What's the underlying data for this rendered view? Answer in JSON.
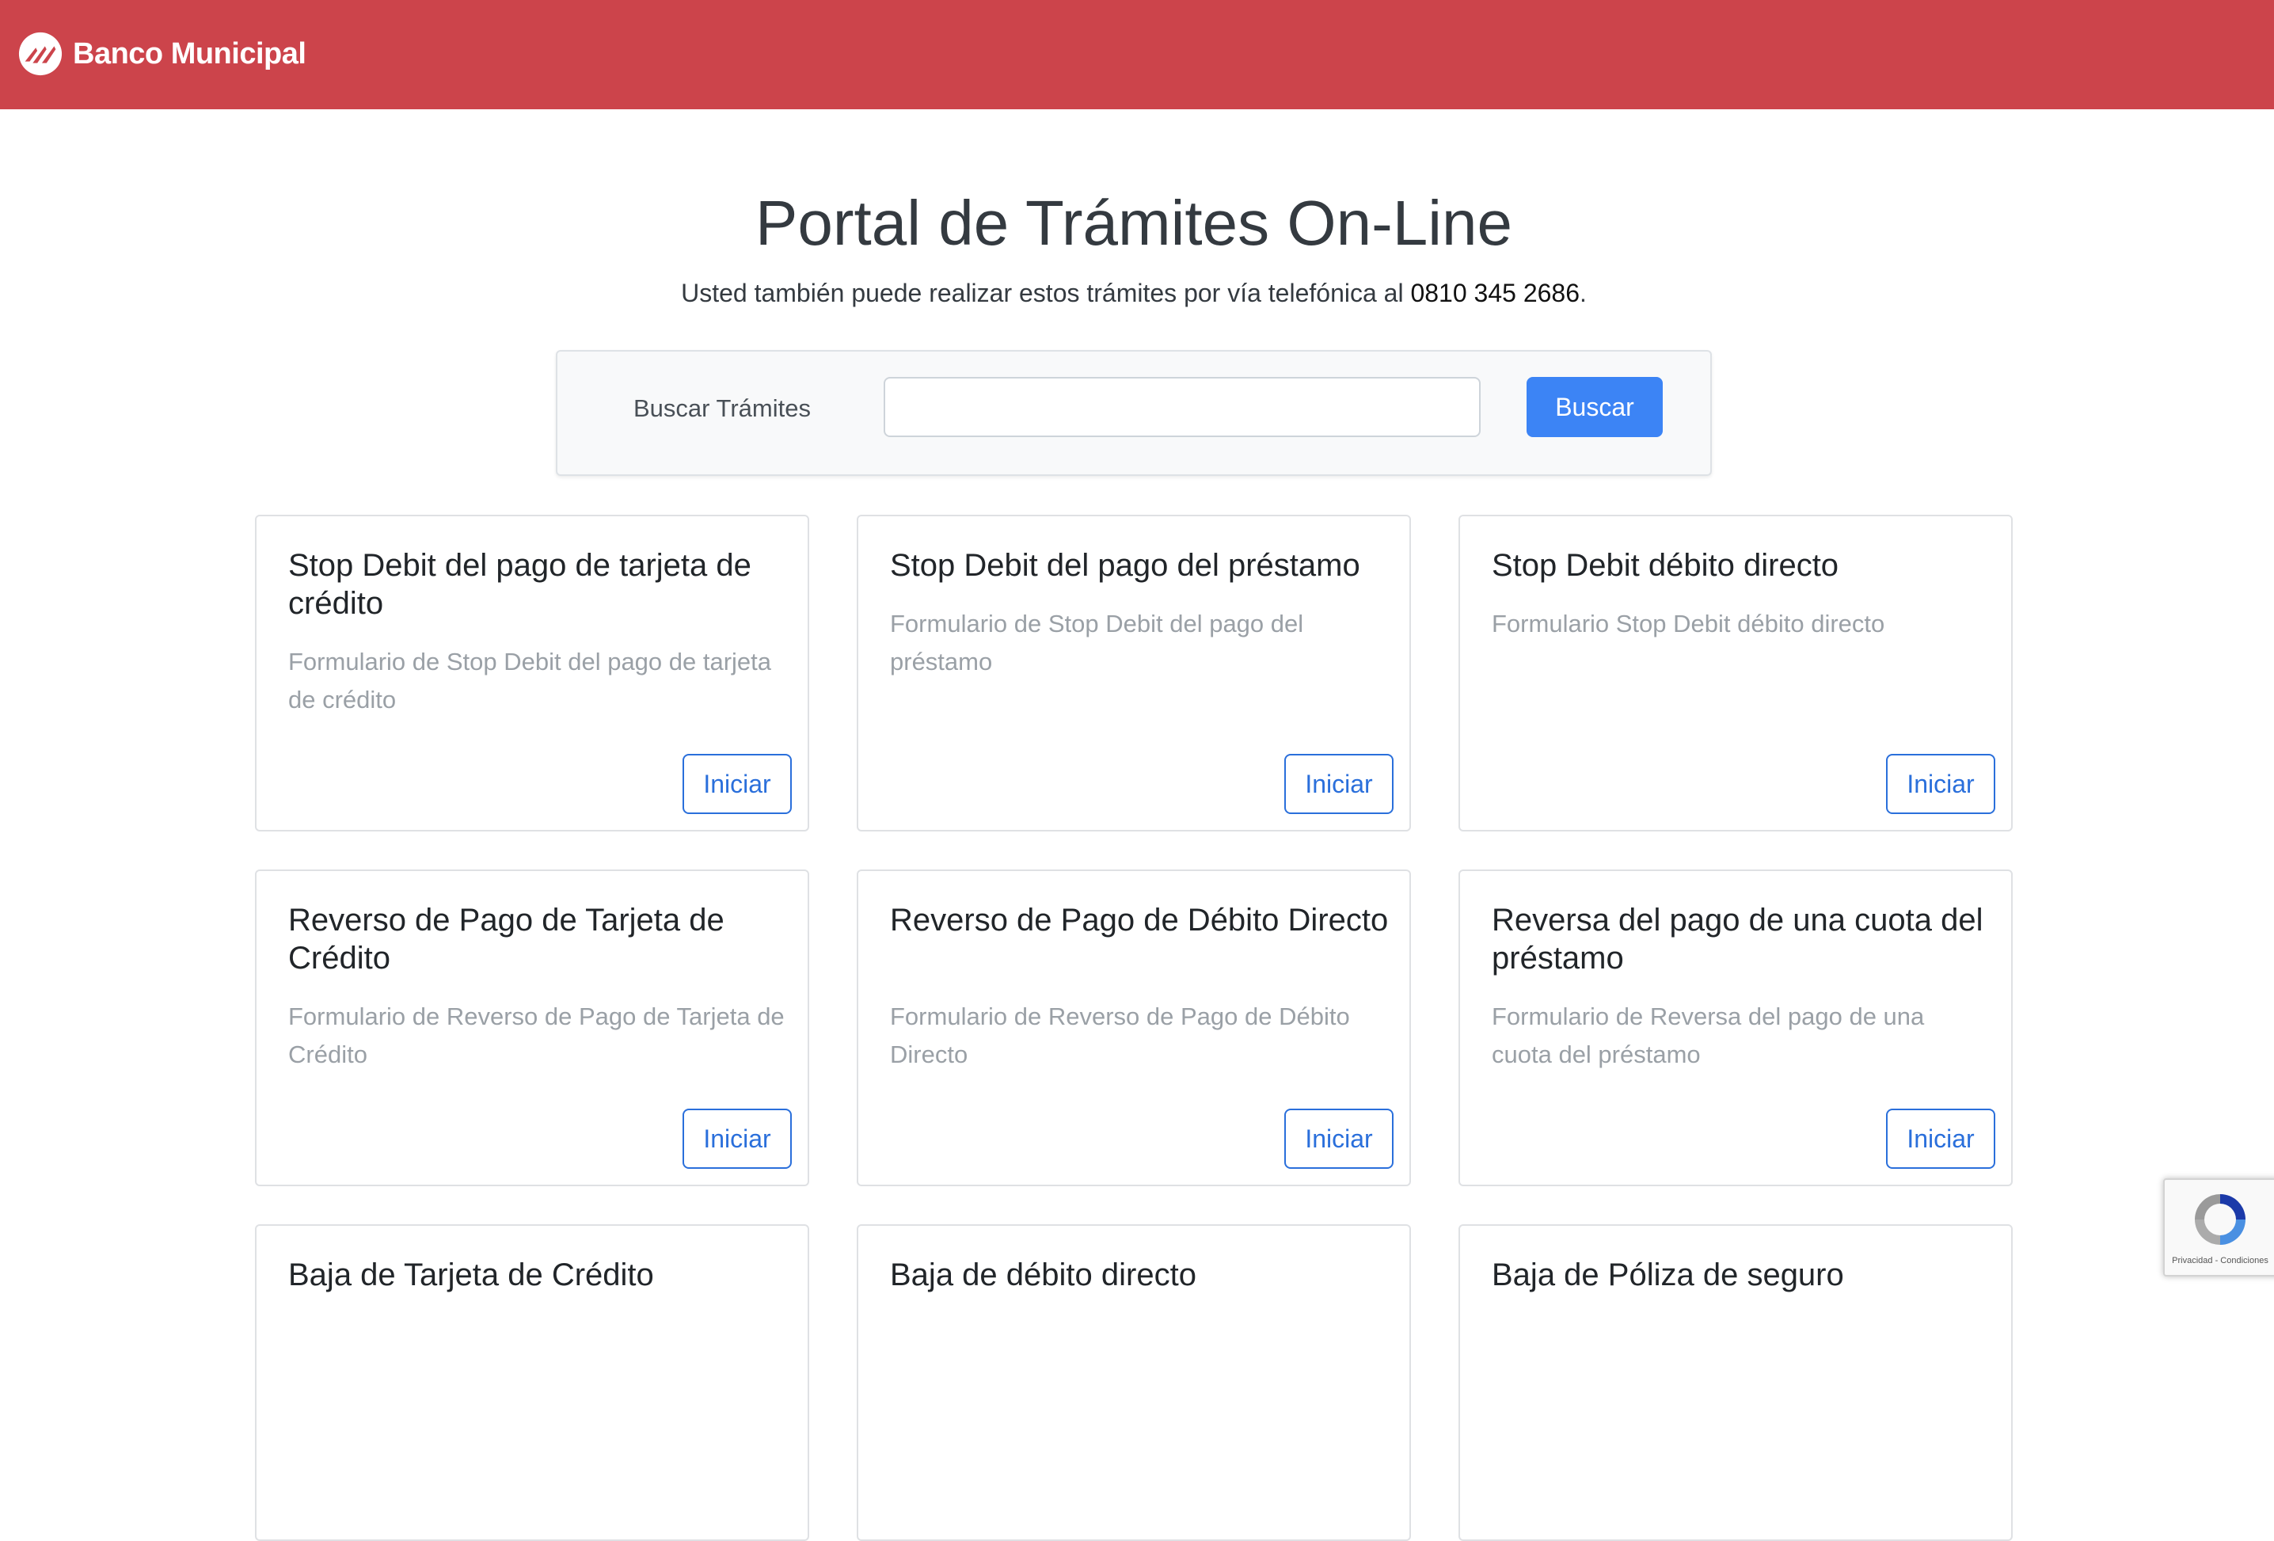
{
  "header": {
    "brand_name": "Banco Municipal",
    "background_color": "#cc444b",
    "logo_icon": "banco-municipal-logo"
  },
  "main": {
    "title": "Portal de Trámites On-Line",
    "subtitle_prefix": "Usted también puede realizar estos trámites por vía telefónica al ",
    "phone": "0810 345 2686",
    "subtitle_suffix": "."
  },
  "search": {
    "label": "Buscar Trámites",
    "value": "",
    "placeholder": "",
    "button_label": "Buscar",
    "button_color": "#3c84f5"
  },
  "cards": [
    {
      "title": "Stop Debit del pago de tarjeta de crédito",
      "description": "Formulario de Stop Debit del pago de tarjeta de crédito",
      "button_label": "Iniciar"
    },
    {
      "title": "Stop Debit del pago del préstamo",
      "description": "Formulario de Stop Debit del pago del préstamo",
      "button_label": "Iniciar"
    },
    {
      "title": "Stop Debit débito directo",
      "description": "Formulario Stop Debit débito directo",
      "button_label": "Iniciar"
    },
    {
      "title": "Reverso de Pago de Tarjeta de Crédito",
      "description": "Formulario de Reverso de Pago de Tarjeta de Crédito",
      "button_label": "Iniciar"
    },
    {
      "title": "Reverso de Pago de Débito Directo",
      "description": "Formulario de Reverso de Pago de Débito Directo",
      "button_label": "Iniciar"
    },
    {
      "title": "Reversa del pago de una cuota del préstamo",
      "description": "Formulario de Reversa del pago de una cuota del préstamo",
      "button_label": "Iniciar"
    },
    {
      "title": "Baja de Tarjeta de Crédito"
    },
    {
      "title": "Baja de débito directo"
    },
    {
      "title": "Baja de Póliza de seguro"
    }
  ],
  "recaptcha": {
    "icon": "recaptcha-icon",
    "text": "Privacidad - Condiciones"
  }
}
